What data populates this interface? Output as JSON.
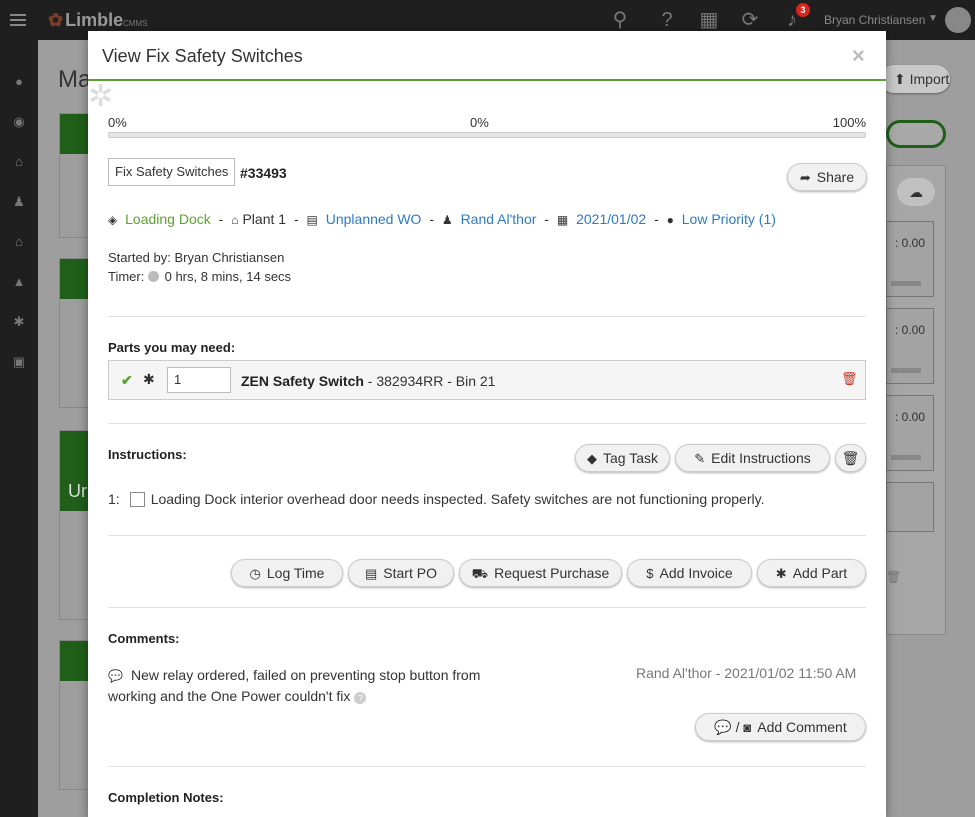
{
  "app": {
    "logo_text": "Limble",
    "logo_suffix": "CMMS",
    "notification_count": "3",
    "user_name": "Bryan Christiansen"
  },
  "background": {
    "page_title_partial": "Ma",
    "import_label": "Import",
    "card_partial_label": "Ur",
    "box_values": [
      ": 0.00",
      ": 0.00",
      ": 0.00"
    ]
  },
  "modal": {
    "title": "View Fix Safety Switches",
    "close_glyph": "×",
    "progress": {
      "start_label": "0%",
      "current_label": "0%",
      "end_label": "100%",
      "value_percent": 0
    },
    "task": {
      "name": "Fix Safety Switches",
      "id": "#33493",
      "share_label": "Share"
    },
    "meta": {
      "location": "Loading Dock",
      "asset": "Plant 1",
      "type": "Unplanned WO",
      "assignee": "Rand Al'thor",
      "due_date": "2021/01/02",
      "priority": "Low Priority (1)",
      "separator": "-"
    },
    "started_by": "Started by: Bryan Christiansen",
    "timer_label": "Timer:",
    "timer_value": "0 hrs, 8 mins, 14 secs",
    "parts": {
      "title": "Parts you may need:",
      "items": [
        {
          "qty": "1",
          "name": "ZEN Safety Switch",
          "detail": " - 382934RR - Bin 21"
        }
      ]
    },
    "instructions": {
      "title": "Instructions:",
      "tag_task_label": "Tag Task",
      "edit_label": "Edit Instructions",
      "items": [
        {
          "number": "1:",
          "text": "Loading Dock interior overhead door needs inspected. Safety switches are not functioning properly."
        }
      ]
    },
    "actions": {
      "log_time": "Log Time",
      "start_po": "Start PO",
      "request_purchase": "Request Purchase",
      "add_invoice": "Add Invoice",
      "add_part": "Add Part"
    },
    "comments": {
      "title": "Comments:",
      "items": [
        {
          "text": "New relay ordered, failed on preventing stop button from working and the One Power couldn't fix",
          "author_time": "Rand Al'thor - 2021/01/02 11:50 AM"
        }
      ],
      "add_label": "Add Comment",
      "add_separator": "/"
    },
    "completion_notes_title": "Completion Notes:"
  },
  "colors": {
    "brand_green": "#5da130",
    "link_blue": "#2f7ac4",
    "danger_red": "#c0392b"
  }
}
